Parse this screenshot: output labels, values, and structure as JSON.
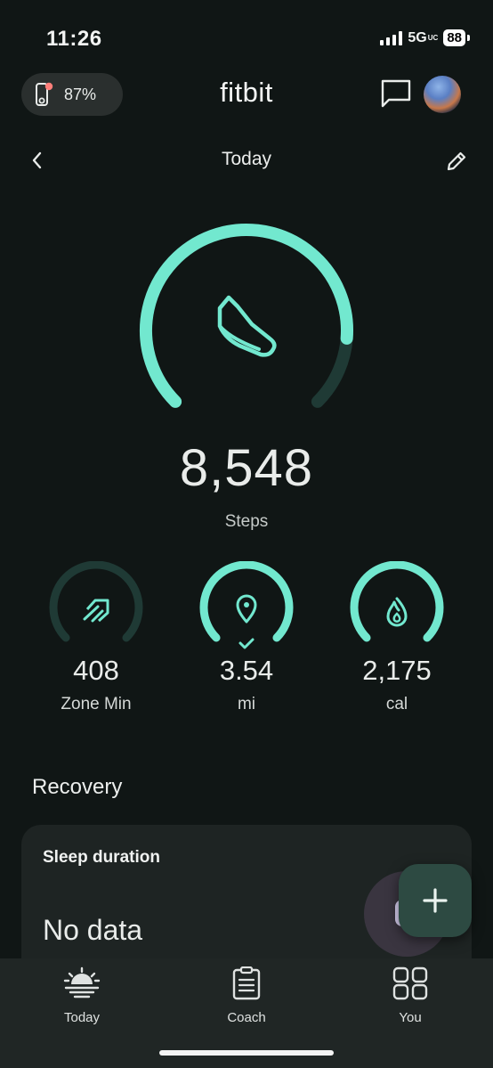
{
  "status_bar": {
    "time": "11:26",
    "network": "5G",
    "network_suffix": "UC",
    "battery": "88"
  },
  "header": {
    "device_battery": "87%",
    "device_alert_color": "#ff7f7a",
    "app_title": "fitbit",
    "icons": [
      "watch-icon",
      "chat-icon",
      "avatar"
    ]
  },
  "nav": {
    "date_label": "Today",
    "icons": [
      "chevron-left-icon",
      "pencil-icon"
    ]
  },
  "steps": {
    "value": "8,548",
    "label": "Steps",
    "progress": 0.85,
    "icon": "shoe-icon",
    "accent": "#72e8cf",
    "track": "#1f3a35"
  },
  "stats": [
    {
      "value": "408",
      "label": "Zone Min",
      "icon": "zone-arrow-icon",
      "progress": 0.0
    },
    {
      "value": "3.54",
      "label": "mi",
      "icon": "location-pin-icon",
      "progress": 1.0,
      "goal_met": true
    },
    {
      "value": "2,175",
      "label": "cal",
      "icon": "flame-icon",
      "progress": 1.0
    }
  ],
  "recovery": {
    "section_title": "Recovery",
    "card_title": "Sleep duration",
    "card_value": "No data"
  },
  "fab": {
    "icon": "plus-icon"
  },
  "bottom_nav": [
    {
      "label": "Today",
      "icon": "sunrise-icon"
    },
    {
      "label": "Coach",
      "icon": "clipboard-icon"
    },
    {
      "label": "You",
      "icon": "grid-icon"
    }
  ]
}
